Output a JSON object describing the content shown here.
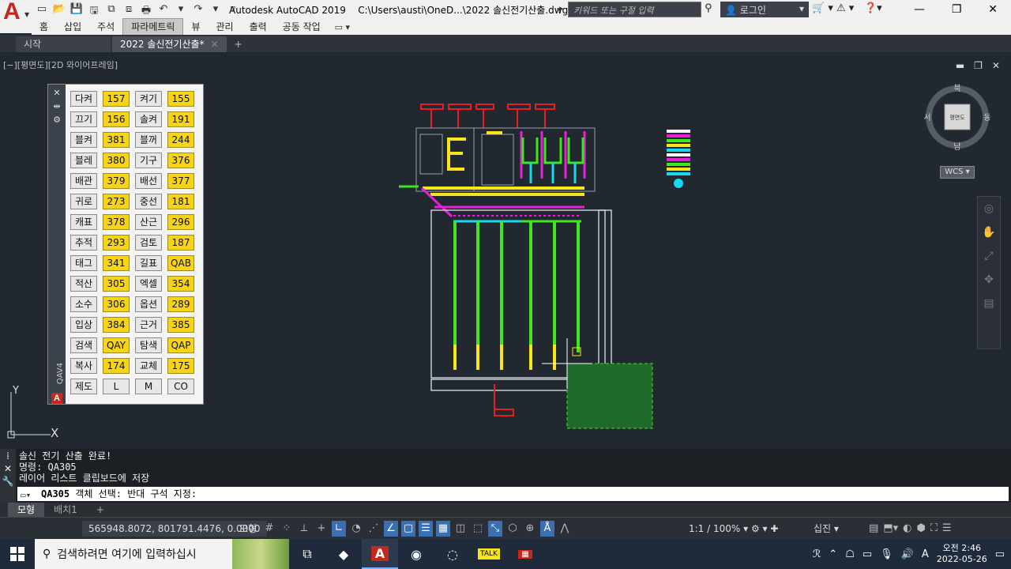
{
  "app": {
    "title": "Autodesk AutoCAD 2019",
    "file_path": "C:\\Users\\austi\\OneD...\\2022 솔신전기산출.dwg",
    "search_placeholder": "키워드 또는 구절 입력",
    "login_label": "로그인"
  },
  "ribbon": {
    "tabs": [
      "홈",
      "삽입",
      "주석",
      "파라메트릭",
      "뷰",
      "관리",
      "출력",
      "공동 작업"
    ],
    "active_tab": "파라메트릭"
  },
  "doc_tabs": {
    "start_label": "시작",
    "active_label": "2022 솔신전기산출*"
  },
  "viewport": {
    "label": "[−][평면도][2D 와이어프레임]",
    "compass": {
      "north": "북",
      "south": "남",
      "east": "동",
      "west": "서",
      "cube_label": "평면도"
    },
    "wcs_label": "WCS",
    "ucs_x": "X",
    "ucs_y": "Y"
  },
  "palette": {
    "vertical_label": "QAV4",
    "rows": [
      [
        "다켜",
        "157",
        "켜기",
        "155"
      ],
      [
        "끄기",
        "156",
        "솔켜",
        "191"
      ],
      [
        "블켜",
        "381",
        "블꺼",
        "244"
      ],
      [
        "블레",
        "380",
        "기구",
        "376"
      ],
      [
        "배관",
        "379",
        "배선",
        "377"
      ],
      [
        "귀로",
        "273",
        "중선",
        "181"
      ],
      [
        "캐표",
        "378",
        "산근",
        "296"
      ],
      [
        "추적",
        "293",
        "검토",
        "187"
      ],
      [
        "태그",
        "341",
        "길표",
        "QAB"
      ],
      [
        "적산",
        "305",
        "엑셀",
        "354"
      ],
      [
        "소수",
        "306",
        "옵션",
        "289"
      ],
      [
        "입상",
        "384",
        "근거",
        "385"
      ],
      [
        "검색",
        "QAY",
        "탐색",
        "QAP"
      ],
      [
        "복사",
        "174",
        "교체",
        "175"
      ],
      [
        "제도",
        "L",
        "M",
        "CO"
      ]
    ]
  },
  "command": {
    "history": [
      "솔신 전기 산출 완료!",
      "명령: QA305",
      "레이어 리스트 클립보드에 저장"
    ],
    "prompt_cmd": "QA305",
    "prompt_text": "객체 선택: 반대 구석 지정:"
  },
  "layout_tabs": [
    "모형",
    "배치1"
  ],
  "status": {
    "coords": "565948.8072, 801791.4476, 0.0000",
    "model": "모형",
    "scale": "1:1 / 100%",
    "workspace": "십진"
  },
  "taskbar": {
    "search_placeholder": "검색하려면 여기에 입력하십시",
    "time": "오전 2:46",
    "date": "2022-05-26",
    "ime": "A"
  },
  "colors": {
    "canvas": "#212830",
    "pipe_green": "#3ee61f",
    "pipe_yellow": "#f7e51a",
    "pipe_magenta": "#e61fd8",
    "pipe_cyan": "#18d8f0",
    "selection_green": "#1f6b2a"
  }
}
